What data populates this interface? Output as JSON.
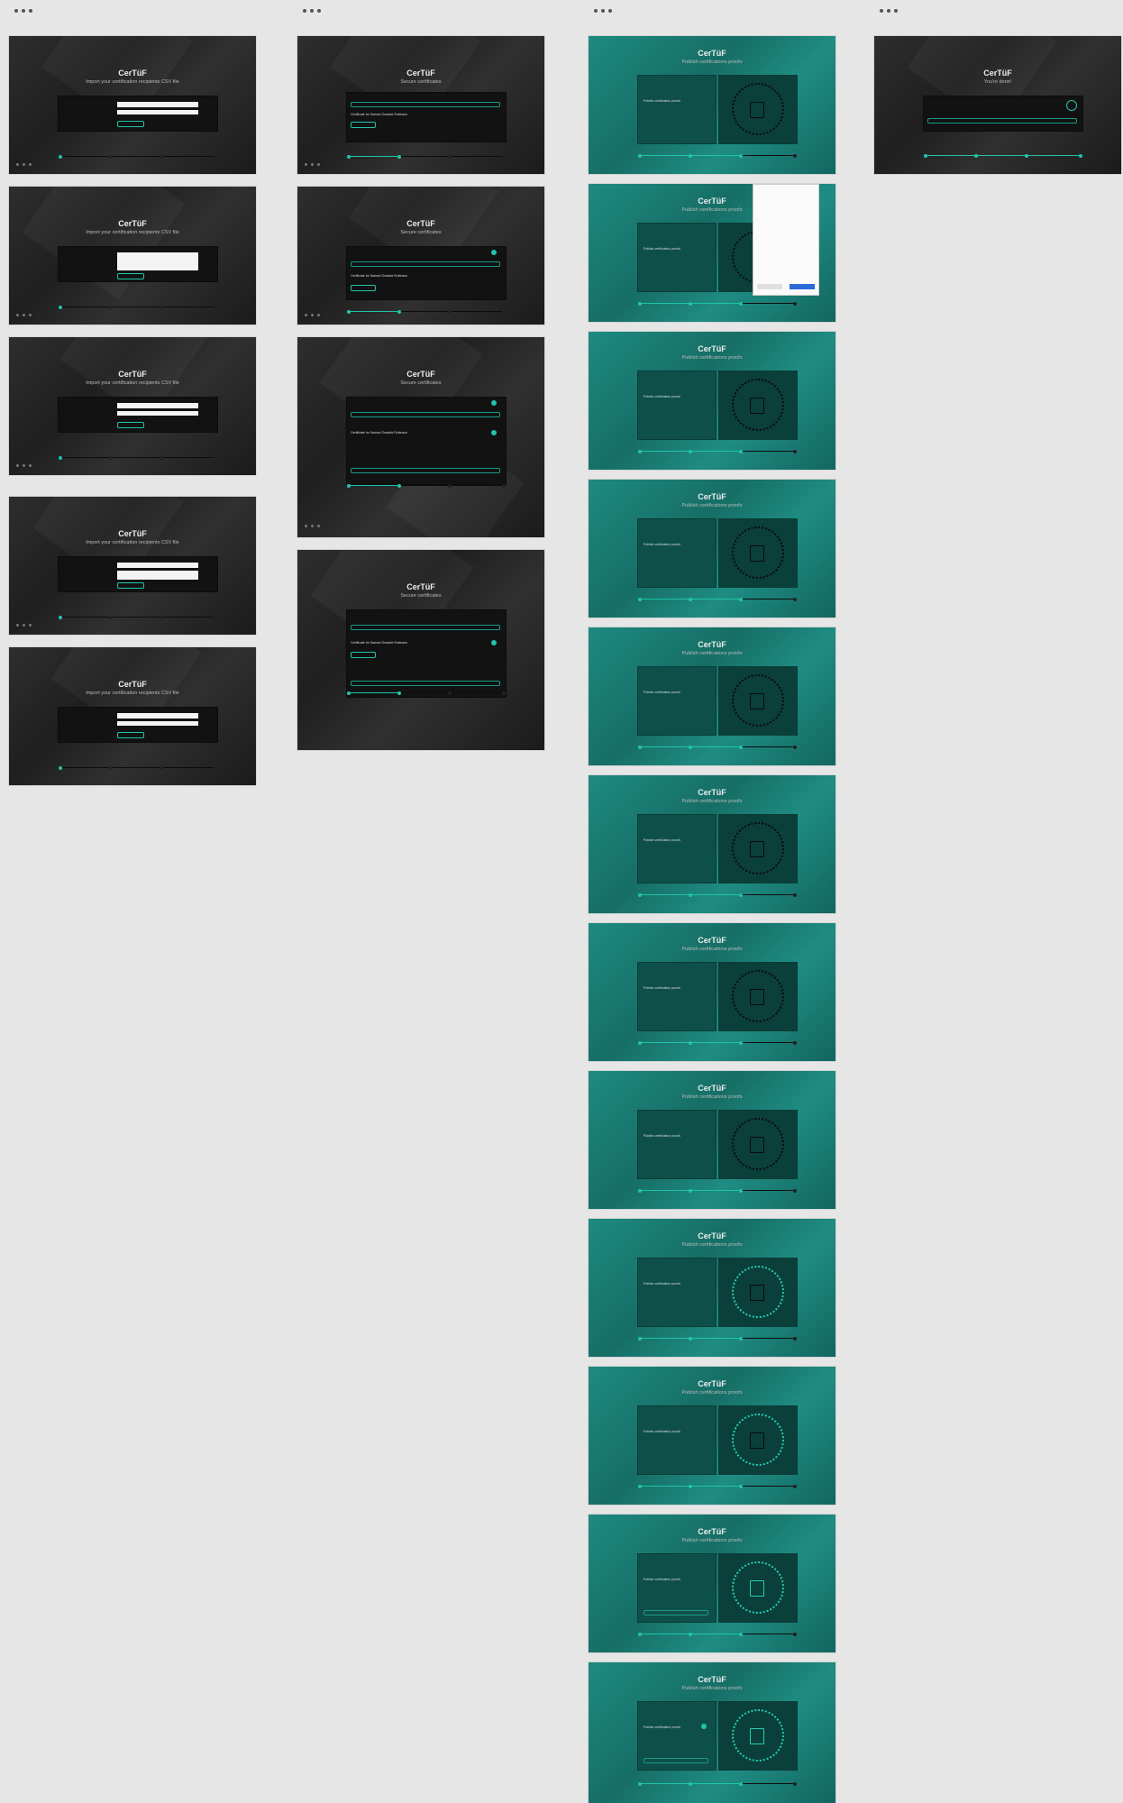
{
  "app_title": "CerTüF",
  "columns": [
    {
      "subtitle": "Import your certification recipients CSV file",
      "boards": 5
    },
    {
      "subtitle": "Secure certificates",
      "boards": 4,
      "row_label": "Certificate for Samuel Owalobi Robinson"
    },
    {
      "subtitle": "Publish certifications proofs",
      "boards": 12,
      "panel_title": "Publish certification proofs"
    },
    {
      "subtitle": "You're done!",
      "boards": 1
    }
  ],
  "colors": {
    "canvas": "#e6e6e6",
    "dark_board": "#262626",
    "teal_board": "#1a7f76",
    "accent": "#20c4aa"
  },
  "icons": [
    "more-dots-icon",
    "document-icon",
    "check-icon"
  ]
}
